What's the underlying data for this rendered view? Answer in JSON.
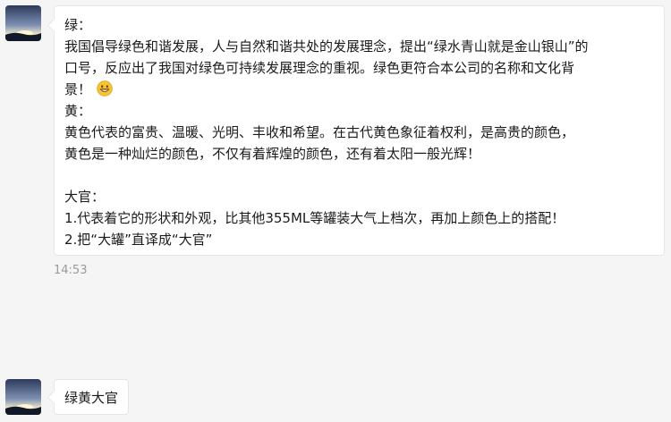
{
  "messages": [
    {
      "lines": [
        "绿：",
        "我国倡导绿色和谐发展，人与自然和谐共处的发展理念，提出“绿水青山就是金山银山”的",
        "口号，反应出了我国对绿色可持续发展理念的重视。绿色更符合本公司的名称和文化背",
        "景！",
        "黄：",
        "黄色代表的富贵、温暖、光明、丰收和希望。在古代黄色象征着权利，是高贵的颜色，",
        "黄色是一种灿烂的颜色，不仅有着辉煌的颜色，还有着太阳一般光辉！",
        "",
        "大官：",
        "1.代表着它的形状和外观，比其他355ML等罐装大气上档次，再加上颜色上的搭配！",
        "2.把“大罐”直译成“大官”"
      ],
      "emoji": "grinning-face-emoji",
      "timestamp": "14:53"
    },
    {
      "text": "绿黄大官"
    }
  ],
  "colors": {
    "background": "#f5f5f5",
    "bubble": "#ffffff",
    "text": "#1a1a1a",
    "timestamp": "#9a9a9a"
  }
}
